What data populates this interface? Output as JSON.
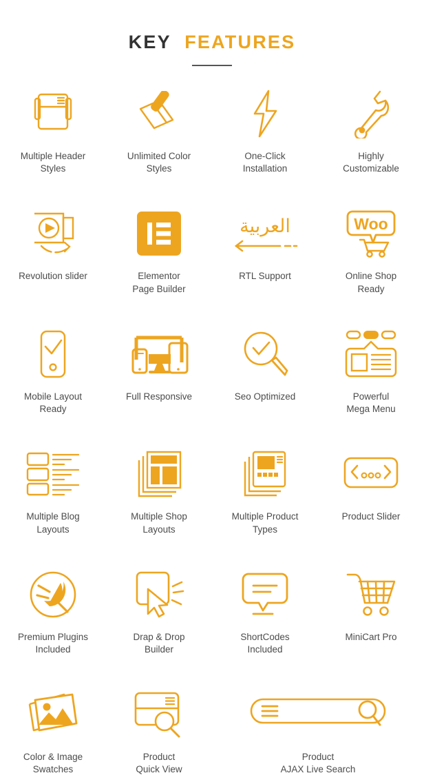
{
  "header": {
    "title_part1": "KEY",
    "title_part2": "FEATURES",
    "accent_color": "#eda520",
    "dark_color": "#333333"
  },
  "text_color": "#4b4b4b",
  "features": [
    {
      "id": "multiple-header-styles",
      "label": "Multiple Header\nStyles",
      "icon": "header-layout-icon"
    },
    {
      "id": "unlimited-color-styles",
      "label": "Unlimited Color\nStyles",
      "icon": "paint-roller-icon"
    },
    {
      "id": "one-click-installation",
      "label": "One-Click\nInstallation",
      "icon": "lightning-bolt-icon"
    },
    {
      "id": "highly-customizable",
      "label": "Highly\nCustomizable",
      "icon": "wrench-icon"
    },
    {
      "id": "revolution-slider",
      "label": "Revolution slider",
      "icon": "video-slider-icon"
    },
    {
      "id": "elementor-page-builder",
      "label": "Elementor\nPage Builder",
      "icon": "elementor-logo-icon"
    },
    {
      "id": "rtl-support",
      "label": "RTL Support",
      "icon": "rtl-arabic-arrow-icon"
    },
    {
      "id": "online-shop-ready",
      "label": "Online Shop\nReady",
      "icon": "woocommerce-logo-icon"
    },
    {
      "id": "mobile-layout-ready",
      "label": "Mobile Layout\nReady",
      "icon": "mobile-check-icon"
    },
    {
      "id": "full-responsive",
      "label": "Full Responsive",
      "icon": "responsive-devices-icon"
    },
    {
      "id": "seo-optimized",
      "label": "Seo Optimized",
      "icon": "magnifier-check-icon"
    },
    {
      "id": "powerful-mega-menu",
      "label": "Powerful\nMega Menu",
      "icon": "mega-menu-icon"
    },
    {
      "id": "multiple-blog-layouts",
      "label": "Multiple Blog\nLayouts",
      "icon": "blog-list-icon"
    },
    {
      "id": "multiple-shop-layouts",
      "label": "Multiple Shop\nLayouts",
      "icon": "shop-pages-icon"
    },
    {
      "id": "multiple-product-types",
      "label": "Multiple Product\nTypes",
      "icon": "product-cards-icon"
    },
    {
      "id": "product-slider",
      "label": "Product Slider",
      "icon": "slider-arrows-icon"
    },
    {
      "id": "premium-plugins",
      "label": "Premium Plugins\nIncluded",
      "icon": "plug-circle-icon"
    },
    {
      "id": "drag-drop-builder",
      "label": "Drap & Drop\nBuilder",
      "icon": "drag-cursor-icon"
    },
    {
      "id": "shortcodes-included",
      "label": "ShortCodes\nIncluded",
      "icon": "speech-bubble-icon"
    },
    {
      "id": "minicart-pro",
      "label": "MiniCart Pro",
      "icon": "shopping-cart-icon"
    },
    {
      "id": "color-image-swatches",
      "label": "Color & Image\nSwatches",
      "icon": "photo-stack-icon"
    },
    {
      "id": "product-quick-view",
      "label": "Product\nQuick View",
      "icon": "quick-view-card-icon"
    },
    {
      "id": "product-ajax-live-search",
      "label": "Product\nAJAX Live Search",
      "icon": "search-bar-icon"
    }
  ]
}
